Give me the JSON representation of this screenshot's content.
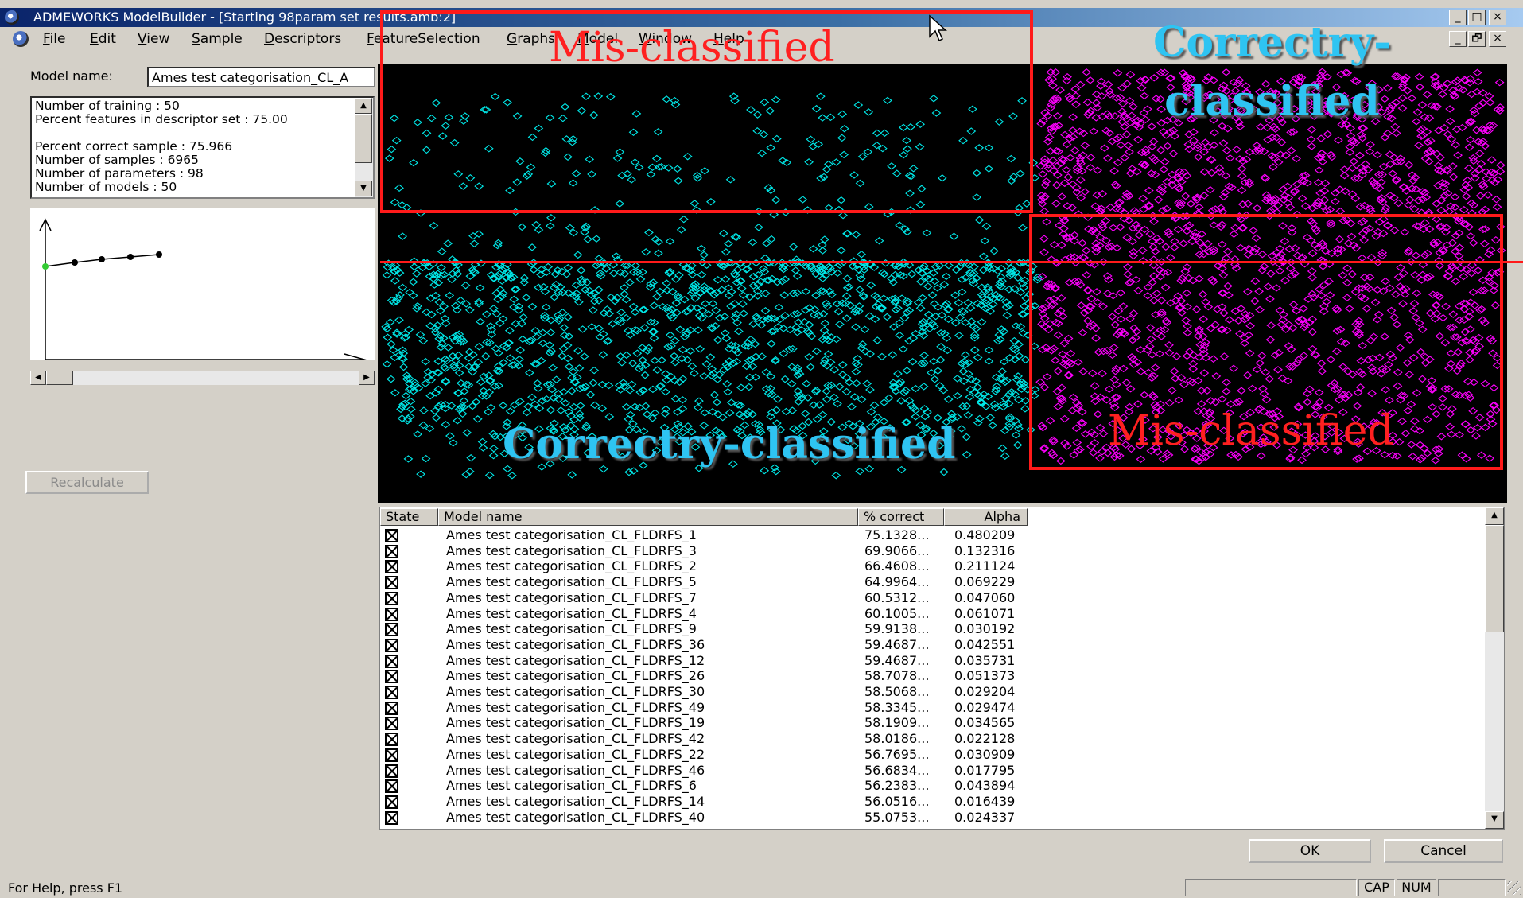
{
  "window": {
    "title": "ADMEWORKS ModelBuilder - [Starting 98param set results.amb:2]",
    "minimize_label": "_",
    "maximize_label": "□",
    "close_label": "×",
    "restore_label": "🗗"
  },
  "menu": [
    "File",
    "Edit",
    "View",
    "Sample",
    "Descriptors",
    "FeatureSelection",
    "Graphs",
    "Model",
    "Window",
    "Help"
  ],
  "left_panel": {
    "model_name_label": "Model name:",
    "model_name_value": "Ames test categorisation_CL_A",
    "info_lines": [
      "Number of training : 50",
      "Percent features in descriptor set : 75.00",
      "",
      "Percent correct sample : 75.966",
      "Number of samples : 6965",
      "Number of parameters : 98",
      "Number of models : 50"
    ],
    "recalculate_label": "Recalculate"
  },
  "annotations": {
    "top_left": "Mis-classified",
    "top_right": "Correctry-\nclassified",
    "bottom_left": "Correctry-classified",
    "bottom_right": "Mis-classified"
  },
  "table": {
    "headers": [
      "State",
      "Model name",
      "% correct",
      "Alpha"
    ],
    "rows": [
      {
        "name": "Ames test categorisation_CL_FLDRFS_1",
        "pct": "75.1328...",
        "alpha": "0.480209"
      },
      {
        "name": "Ames test categorisation_CL_FLDRFS_3",
        "pct": "69.9066...",
        "alpha": "0.132316"
      },
      {
        "name": "Ames test categorisation_CL_FLDRFS_2",
        "pct": "66.4608...",
        "alpha": "0.211124"
      },
      {
        "name": "Ames test categorisation_CL_FLDRFS_5",
        "pct": "64.9964...",
        "alpha": "0.069229"
      },
      {
        "name": "Ames test categorisation_CL_FLDRFS_7",
        "pct": "60.5312...",
        "alpha": "0.047060"
      },
      {
        "name": "Ames test categorisation_CL_FLDRFS_4",
        "pct": "60.1005...",
        "alpha": "0.061071"
      },
      {
        "name": "Ames test categorisation_CL_FLDRFS_9",
        "pct": "59.9138...",
        "alpha": "0.030192"
      },
      {
        "name": "Ames test categorisation_CL_FLDRFS_36",
        "pct": "59.4687...",
        "alpha": "0.042551"
      },
      {
        "name": "Ames test categorisation_CL_FLDRFS_12",
        "pct": "59.4687...",
        "alpha": "0.035731"
      },
      {
        "name": "Ames test categorisation_CL_FLDRFS_26",
        "pct": "58.7078...",
        "alpha": "0.051373"
      },
      {
        "name": "Ames test categorisation_CL_FLDRFS_30",
        "pct": "58.5068...",
        "alpha": "0.029204"
      },
      {
        "name": "Ames test categorisation_CL_FLDRFS_49",
        "pct": "58.3345...",
        "alpha": "0.029474"
      },
      {
        "name": "Ames test categorisation_CL_FLDRFS_19",
        "pct": "58.1909...",
        "alpha": "0.034565"
      },
      {
        "name": "Ames test categorisation_CL_FLDRFS_42",
        "pct": "58.0186...",
        "alpha": "0.022128"
      },
      {
        "name": "Ames test categorisation_CL_FLDRFS_22",
        "pct": "56.7695...",
        "alpha": "0.030909"
      },
      {
        "name": "Ames test categorisation_CL_FLDRFS_46",
        "pct": "56.6834...",
        "alpha": "0.017795"
      },
      {
        "name": "Ames test categorisation_CL_FLDRFS_6",
        "pct": "56.2383...",
        "alpha": "0.043894"
      },
      {
        "name": "Ames test categorisation_CL_FLDRFS_14",
        "pct": "56.0516...",
        "alpha": "0.016439"
      },
      {
        "name": "Ames test categorisation_CL_FLDRFS_40",
        "pct": "55.0753...",
        "alpha": "0.024337"
      }
    ]
  },
  "buttons": {
    "ok": "OK",
    "cancel": "Cancel"
  },
  "status": {
    "help_text": "For Help, press F1",
    "cap": "CAP",
    "num": "NUM"
  },
  "colors": {
    "class_a_points": "#00e8e8",
    "class_b_points": "#ff00ff",
    "annotation_red": "#ff1a1a",
    "annotation_cyan": "#2ec4f2"
  }
}
